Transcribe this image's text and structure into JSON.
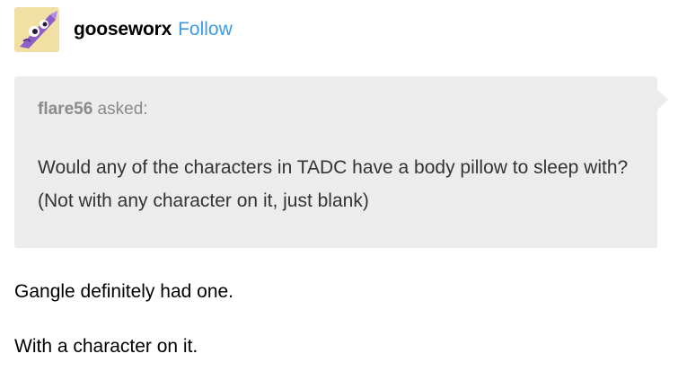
{
  "header": {
    "blog_name": "gooseworx",
    "follow_label": "Follow",
    "avatar_icon": "purple-goose-avatar-icon"
  },
  "ask": {
    "asker": "flare56",
    "asked_label": " asked:",
    "question": "Would any of the characters in TADC have a body pillow to sleep with? (Not with any character on it, just blank)"
  },
  "answer": {
    "paragraphs": [
      "Gangle definitely had one.",
      "With a character on it."
    ]
  },
  "colors": {
    "follow": "#3b9be0",
    "ask_background": "#ececec",
    "asker_text": "#8a8a8a",
    "avatar_background": "#f1dfa3",
    "avatar_figure": "#8e5fc9"
  }
}
